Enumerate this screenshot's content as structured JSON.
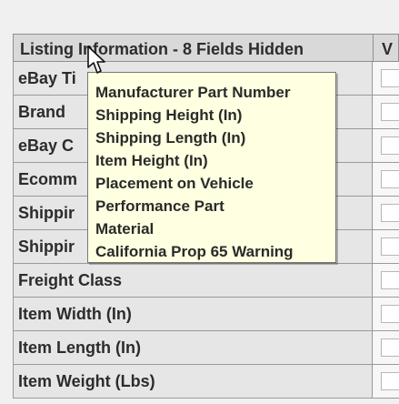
{
  "header": {
    "title": "Listing Information - 8 Fields Hidden",
    "right_label": "V"
  },
  "rows": [
    {
      "label": "eBay Ti"
    },
    {
      "label": "Brand"
    },
    {
      "label": "eBay C"
    },
    {
      "label": "Ecomm"
    },
    {
      "label": "Shippir"
    },
    {
      "label": "Shippir"
    },
    {
      "label": "Freight Class"
    },
    {
      "label": "Item Width (In)"
    },
    {
      "label": "Item Length (In)"
    },
    {
      "label": "Item Weight (Lbs)"
    }
  ],
  "tooltip": {
    "items": [
      "Manufacturer Part Number",
      "Shipping Height (In)",
      "Shipping Length (In)",
      "Item Height (In)",
      "Placement on Vehicle",
      "Performance Part",
      "Material",
      "California Prop 65 Warning"
    ]
  },
  "icons": {
    "cursor": "mouse-pointer-icon"
  },
  "colors": {
    "tooltip_background": "#ffffe1",
    "header_background": "#d9d9d9",
    "row_background": "#e6e6e6",
    "grid_border": "#9a9a9a"
  }
}
